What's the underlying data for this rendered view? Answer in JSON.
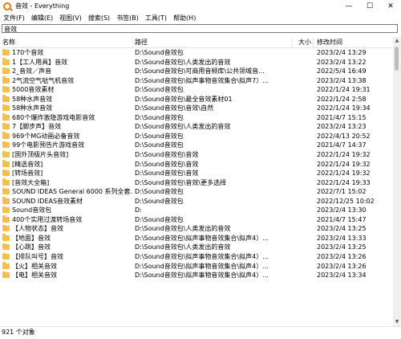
{
  "window": {
    "title": "音效 - Everything",
    "minimize": "—",
    "maximize": "☐",
    "close": "✕"
  },
  "menu": [
    "文件(F)",
    "编辑(E)",
    "视图(V)",
    "搜索(S)",
    "书签(B)",
    "工具(T)",
    "帮助(H)"
  ],
  "search": {
    "value": "音效"
  },
  "columns": {
    "name": "名称",
    "path": "路径",
    "size": "大小",
    "modified": "修改时间"
  },
  "rows": [
    {
      "name": "170个音效",
      "path": "D:\\Sound音效包",
      "modified": "2023/2/4 13:29"
    },
    {
      "name": "1【工人用具】音效",
      "path": "D:\\Sound音效包\\人类发出的音效",
      "modified": "2023/2/4 13:22"
    },
    {
      "name": "2_音效／声音",
      "path": "D:\\Sound音效包\\可商用音频库\\公共领域音...",
      "modified": "2022/5/4 16:49"
    },
    {
      "name": "2气流空气哒气机音效",
      "path": "D:\\Sound音效包\\拟声事物音效集合\\拟声7）...",
      "modified": "2023/2/4 13:38"
    },
    {
      "name": "5000音效素材",
      "path": "D:\\Sound音效包",
      "modified": "2022/1/24 19:31"
    },
    {
      "name": "58种水声音效",
      "path": "D:\\Sound音效包\\最全音效素材01",
      "modified": "2022/1/24 2:58"
    },
    {
      "name": "58种水声音效",
      "path": "D:\\Sound音效包\\音效\\自然",
      "modified": "2022/1/24 19:34"
    },
    {
      "name": "680个爆炸激隐游戏电影音效",
      "path": "D:\\Sound音效包",
      "modified": "2021/4/7 15:15"
    },
    {
      "name": "7【脚步声】音效",
      "path": "D:\\Sound音效包\\人类发出的音效",
      "modified": "2023/2/4 13:23"
    },
    {
      "name": "969个MG动画必备音效",
      "path": "D:\\Sound音效包",
      "modified": "2022/4/13 20:52"
    },
    {
      "name": "99个电影预告片游戏音效",
      "path": "D:\\Sound音效包",
      "modified": "2021/4/7 14:37"
    },
    {
      "name": "[国外顶级片头音效]",
      "path": "D:\\Sound音效包\\音效",
      "modified": "2022/1/24 19:32"
    },
    {
      "name": "[精选音效]",
      "path": "D:\\Sound音效包\\音效",
      "modified": "2022/1/24 19:32"
    },
    {
      "name": "[转场音效]",
      "path": "D:\\Sound音效包\\音效",
      "modified": "2022/1/24 19:32"
    },
    {
      "name": "[音效大全箱]",
      "path": "D:\\Sound音效包\\音效\\更多选择",
      "modified": "2022/1/24 19:33"
    },
    {
      "name": "SOUND IDEAS General 6000 系列全套...",
      "path": "D:\\Sound音效包",
      "modified": "2022/7/1 15:02"
    },
    {
      "name": "SOUND IDEAS音效素材",
      "path": "D:\\Sound音效包",
      "modified": "2022/12/25 10:02"
    },
    {
      "name": "Sound音效包",
      "path": "D:",
      "modified": "2023/2/4 13:30"
    },
    {
      "name": "400个实用过渡转场音效",
      "path": "D:\\Sound音效包",
      "modified": "2021/4/7 15:47"
    },
    {
      "name": "【人物状态】音效",
      "path": "D:\\Sound音效包\\人类发出的音效",
      "modified": "2023/2/4 13:25"
    },
    {
      "name": "【地面】音效",
      "path": "D:\\Sound音效包\\拟声事物音效集合\\拟声4）...",
      "modified": "2023/2/4 13:33"
    },
    {
      "name": "【心跳】音效",
      "path": "D:\\Sound音效包\\人类发出的音效",
      "modified": "2023/2/4 13:25"
    },
    {
      "name": "【排队叫号】音效",
      "path": "D:\\Sound音效包\\拟声事物音效集合\\拟声4）...",
      "modified": "2023/2/4 13:26"
    },
    {
      "name": "【火】相关音效",
      "path": "D:\\Sound音效包\\拟声事物音效集合\\拟声4）...",
      "modified": "2023/2/4 13:26"
    },
    {
      "name": "【电】相关音效",
      "path": "D:\\Sound音效包\\拟声事物音效集合\\拟声4）...",
      "modified": "2023/2/4 13:34"
    }
  ],
  "status": {
    "text": "921 个对象"
  },
  "colors": {
    "folder": "#f5c04a"
  }
}
